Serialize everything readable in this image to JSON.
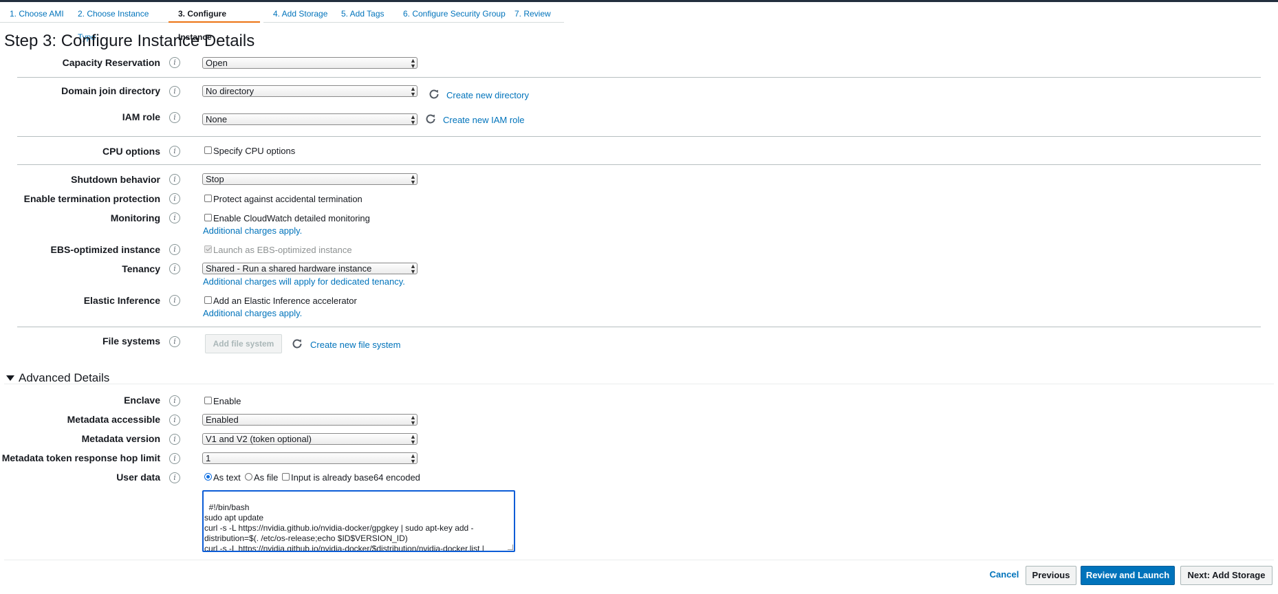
{
  "tabs": [
    {
      "label": "1. Choose AMI",
      "active": false
    },
    {
      "label": "2. Choose Instance Type",
      "active": false
    },
    {
      "label": "3. Configure Instance",
      "active": true
    },
    {
      "label": "4. Add Storage",
      "active": false
    },
    {
      "label": "5. Add Tags",
      "active": false
    },
    {
      "label": "6. Configure Security Group",
      "active": false
    },
    {
      "label": "7. Review",
      "active": false
    }
  ],
  "page_title": "Step 3: Configure Instance Details",
  "info_glyph": "i",
  "fields": {
    "capacity_reservation": {
      "label": "Capacity Reservation",
      "value": "Open"
    },
    "domain_join": {
      "label": "Domain join directory",
      "value": "No directory",
      "link": "Create new directory"
    },
    "iam_role": {
      "label": "IAM role",
      "value": "None",
      "link": "Create new IAM role"
    },
    "cpu_options": {
      "label": "CPU options",
      "checkbox": "Specify CPU options"
    },
    "shutdown": {
      "label": "Shutdown behavior",
      "value": "Stop"
    },
    "termination": {
      "label": "Enable termination protection",
      "checkbox": "Protect against accidental termination"
    },
    "monitoring": {
      "label": "Monitoring",
      "checkbox": "Enable CloudWatch detailed monitoring",
      "note": "Additional charges apply."
    },
    "ebs": {
      "label": "EBS-optimized instance",
      "checkbox": "Launch as EBS-optimized instance"
    },
    "tenancy": {
      "label": "Tenancy",
      "value": "Shared - Run a shared hardware instance",
      "note": "Additional charges will apply for dedicated tenancy."
    },
    "elastic_inference": {
      "label": "Elastic Inference",
      "checkbox": "Add an Elastic Inference accelerator",
      "note": "Additional charges apply."
    },
    "file_systems": {
      "label": "File systems",
      "button": "Add file system",
      "link": "Create new file system"
    }
  },
  "advanced": {
    "title": "Advanced Details",
    "enclave": {
      "label": "Enclave",
      "checkbox": "Enable"
    },
    "metadata_accessible": {
      "label": "Metadata accessible",
      "value": "Enabled"
    },
    "metadata_version": {
      "label": "Metadata version",
      "value": "V1 and V2 (token optional)"
    },
    "hop_limit": {
      "label": "Metadata token response hop limit",
      "value": "1"
    },
    "user_data": {
      "label": "User data",
      "as_text": "As text",
      "as_file": "As file",
      "base64": "Input is already base64 encoded",
      "content": "#!/bin/bash\nsudo apt update\ncurl -s -L https://nvidia.github.io/nvidia-docker/gpgkey | sudo apt-key add -\ndistribution=$(. /etc/os-release;echo $ID$VERSION_ID)\ncurl -s -L https://nvidia.github.io/nvidia-docker/$distribution/nvidia-docker.list |\nsudo tee /etc/apt/sources.list.d/nvidia-docker.list"
    }
  },
  "footer": {
    "cancel": "Cancel",
    "previous": "Previous",
    "review_launch": "Review and Launch",
    "next": "Next: Add Storage"
  },
  "colors": {
    "accent": "#0073bb",
    "active_tab": "#ec7211",
    "header": "#232f3e"
  }
}
